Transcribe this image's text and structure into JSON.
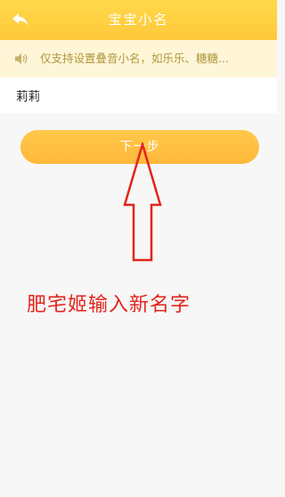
{
  "header": {
    "title": "宝宝小名",
    "back_icon": "back-arrow-icon",
    "background_color": "#ffd84a"
  },
  "notice": {
    "icon": "speaker-icon",
    "text": "仅支持设置叠音小名，如乐乐、糖糖..."
  },
  "name_input": {
    "value": "莉莉"
  },
  "next_button": {
    "label": "下一步",
    "color": "#ffb83a"
  },
  "annotation": {
    "text": "肥宅姬输入新名字",
    "arrow_icon": "red-outline-up-arrow",
    "color": "#e3241b"
  }
}
